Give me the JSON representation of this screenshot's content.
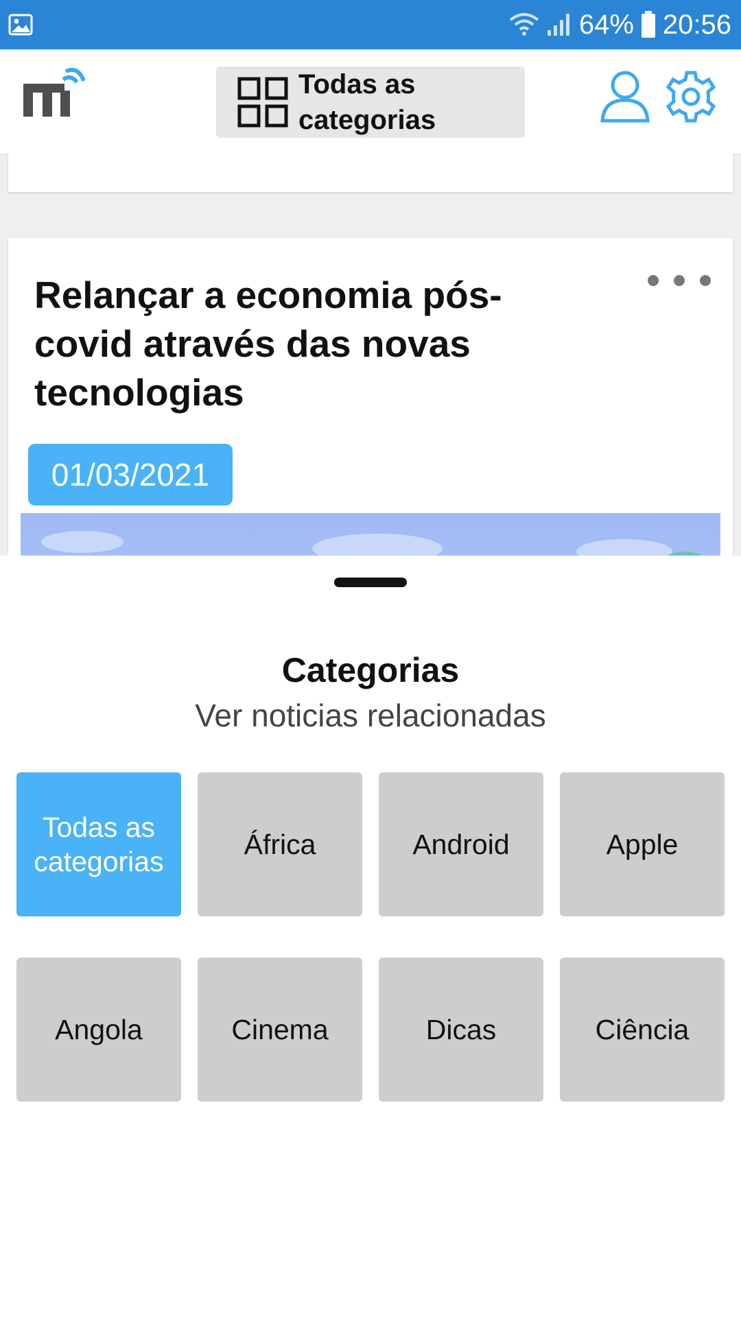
{
  "status_bar": {
    "battery": "64%",
    "time": "20:56",
    "icons": [
      "image-icon",
      "wifi-icon",
      "signal-icon",
      "battery-icon"
    ]
  },
  "header": {
    "category_selector_label": "Todas as categorias",
    "icons": [
      "logo-icon",
      "grid-icon",
      "user-icon",
      "gear-icon"
    ]
  },
  "feed": {
    "article": {
      "title": "Relançar a economia pós-covid através das novas tecnologias",
      "date": "01/03/2021"
    }
  },
  "categories_sheet": {
    "title": "Categorias",
    "subtitle": "Ver noticias relacionadas",
    "items": [
      {
        "label": "Todas as categorias",
        "selected": true
      },
      {
        "label": "África",
        "selected": false
      },
      {
        "label": "Android",
        "selected": false
      },
      {
        "label": "Apple",
        "selected": false
      },
      {
        "label": "Angola",
        "selected": false
      },
      {
        "label": "Cinema",
        "selected": false
      },
      {
        "label": "Dicas",
        "selected": false
      },
      {
        "label": "Ciência",
        "selected": false
      }
    ]
  },
  "colors": {
    "status_bar": "#2a85d6",
    "accent": "#4ab3f7",
    "tile": "#cdcdcd"
  }
}
